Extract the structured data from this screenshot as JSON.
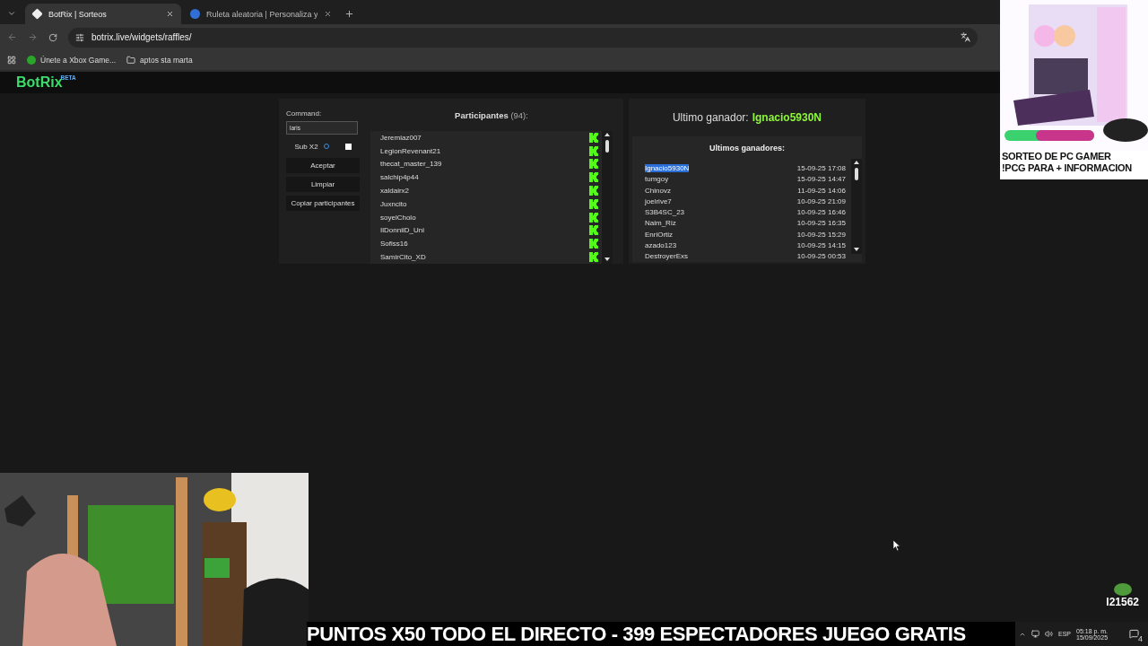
{
  "browser": {
    "tabs": [
      {
        "title": "BotRix | Sorteos",
        "selected": true
      },
      {
        "title": "Ruleta aleatoria | Personaliza y",
        "selected": false
      }
    ],
    "url": "botrix.live/widgets/raffles/",
    "bookmarks": [
      "Únete a Xbox Game...",
      "aptos sta marta"
    ]
  },
  "header": {
    "logo": "BotRix",
    "badge": "BETA"
  },
  "controls": {
    "command_label": "Command:",
    "command_value": "laris",
    "sub_label": "Sub X2",
    "sub_checked": false,
    "buttons": [
      "Aceptar",
      "Limpiar",
      "Copiar participantes"
    ]
  },
  "participants": {
    "title": "Participantes",
    "count": "(94):",
    "items": [
      "Jeremiaz007",
      "LegionRevenant21",
      "thecat_master_139",
      "salchip4p44",
      "xaldairx2",
      "Juxncito",
      "soyelCholo",
      "IlDonniiD_Uni",
      "Sofiss16",
      "SamirCito_XD"
    ]
  },
  "winner": {
    "label": "Ultimo ganador:",
    "name": "Ignacio5930N"
  },
  "winners": {
    "title": "Ultimos ganadores:",
    "items": [
      {
        "name": "Ignacio5930N",
        "date": "15-09-25 17:08",
        "selected": true
      },
      {
        "name": "tumgoy",
        "date": "15-09-25 14:47",
        "selected": false
      },
      {
        "name": "Chinovz",
        "date": "11-09-25 14:06",
        "selected": false
      },
      {
        "name": "joelrive7",
        "date": "10-09-25 21:09",
        "selected": false
      },
      {
        "name": "S3B4SC_23",
        "date": "10-09-25 16:46",
        "selected": false
      },
      {
        "name": "Naim_Riz",
        "date": "10-09-25 16:35",
        "selected": false
      },
      {
        "name": "EnriOrtiz",
        "date": "10-09-25 15:29",
        "selected": false
      },
      {
        "name": "azado123",
        "date": "10-09-25 14:15",
        "selected": false
      },
      {
        "name": "DestroyerExs",
        "date": "10-09-25 00:53",
        "selected": false
      }
    ]
  },
  "overlay": {
    "ad_lines": [
      "SORTEO DE PC GAMER",
      "!PCG PARA + INFORMACION"
    ],
    "viewer_tag": "I21562",
    "banner": "PUNTOS X50 TODO EL DIRECTO - 399 ESPECTADORES JUEGO GRATIS"
  },
  "taskbar": {
    "language": "ESP",
    "time": "05:18 p. m.",
    "date": "15/09/2025",
    "notifications": "4"
  }
}
